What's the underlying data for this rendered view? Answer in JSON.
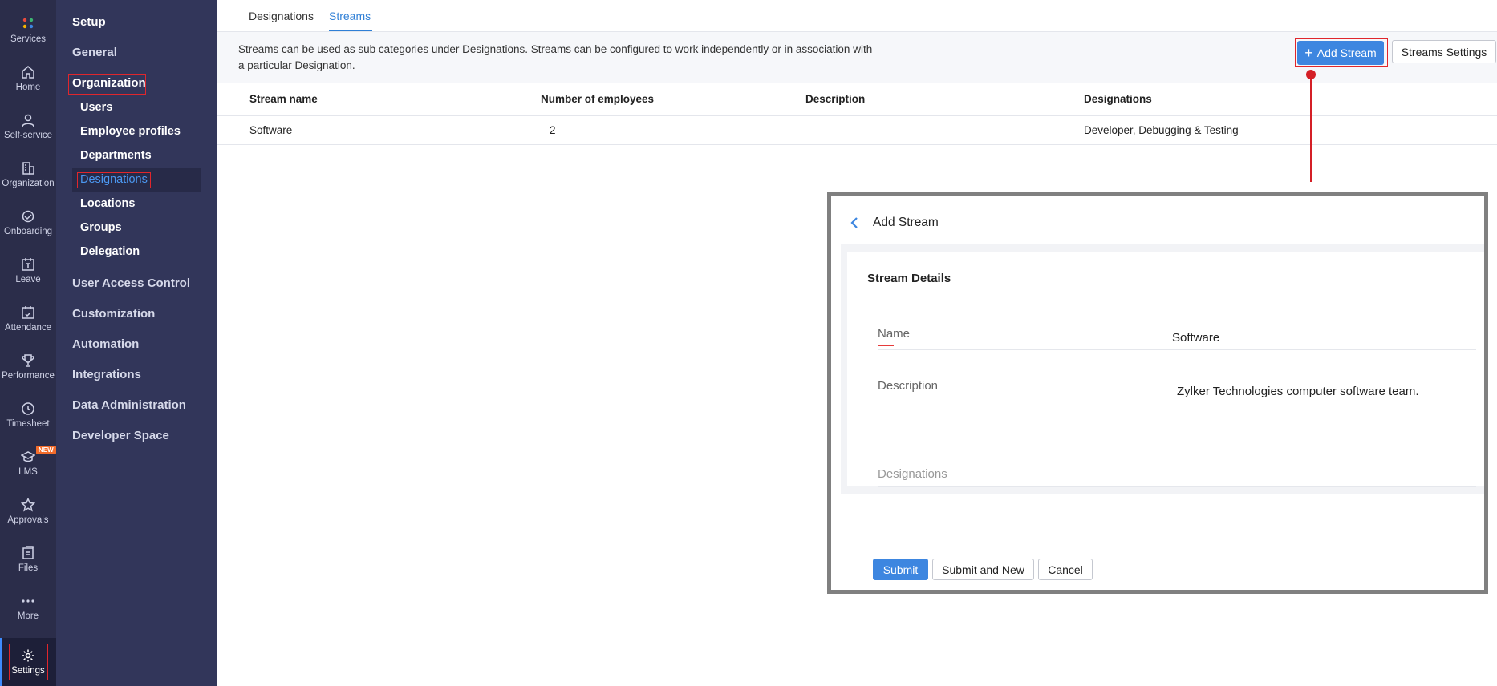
{
  "rail": {
    "items": [
      {
        "label": "Services",
        "icon": "services-icon"
      },
      {
        "label": "Home",
        "icon": "home-icon"
      },
      {
        "label": "Self-service",
        "icon": "user-icon"
      },
      {
        "label": "Organization",
        "icon": "building-icon"
      },
      {
        "label": "Onboarding",
        "icon": "handshake-icon"
      },
      {
        "label": "Leave",
        "icon": "calendar-t-icon"
      },
      {
        "label": "Attendance",
        "icon": "calendar-check-icon"
      },
      {
        "label": "Performance",
        "icon": "trophy-icon"
      },
      {
        "label": "Timesheet",
        "icon": "clock-icon"
      },
      {
        "label": "LMS",
        "icon": "graduation-cap-icon"
      },
      {
        "label": "Approvals",
        "icon": "star-icon"
      },
      {
        "label": "Files",
        "icon": "files-icon"
      },
      {
        "label": "More",
        "icon": "ellipsis-icon"
      },
      {
        "label": "Settings",
        "icon": "gear-icon"
      }
    ],
    "new_badge": "NEW"
  },
  "menu": {
    "setup": "Setup",
    "general": "General",
    "organization": "Organization",
    "sub_items": [
      "Users",
      "Employee profiles",
      "Departments",
      "Designations",
      "Locations",
      "Groups",
      "Delegation"
    ],
    "sections": [
      "User Access Control",
      "Customization",
      "Automation",
      "Integrations",
      "Data Administration",
      "Developer Space"
    ]
  },
  "tabs": [
    "Designations",
    "Streams"
  ],
  "info": {
    "text": "Streams can be used as sub categories under Designations. Streams can be configured to work independently or in association with a particular Designation.",
    "add_stream": "Add Stream",
    "streams_settings": "Streams Settings"
  },
  "table": {
    "headers": [
      "Stream name",
      "Number of employees",
      "Description",
      "Designations"
    ],
    "rows": [
      {
        "name": "Software",
        "employees": "2",
        "description": "",
        "designations": "Developer, Debugging & Testing"
      }
    ]
  },
  "popup": {
    "title": "Add Stream",
    "section_title": "Stream Details",
    "name_label": "Name",
    "name_value": "Software",
    "description_label": "Description",
    "description_value": "Zylker Technologies computer software team.",
    "designations_label": "Designations",
    "submit": "Submit",
    "submit_and_new": "Submit and New",
    "cancel": "Cancel"
  },
  "colors": {
    "accent": "#3d86e0",
    "highlight": "#e0262c",
    "rail": "#2b2d4a",
    "menu": "#32365a"
  }
}
